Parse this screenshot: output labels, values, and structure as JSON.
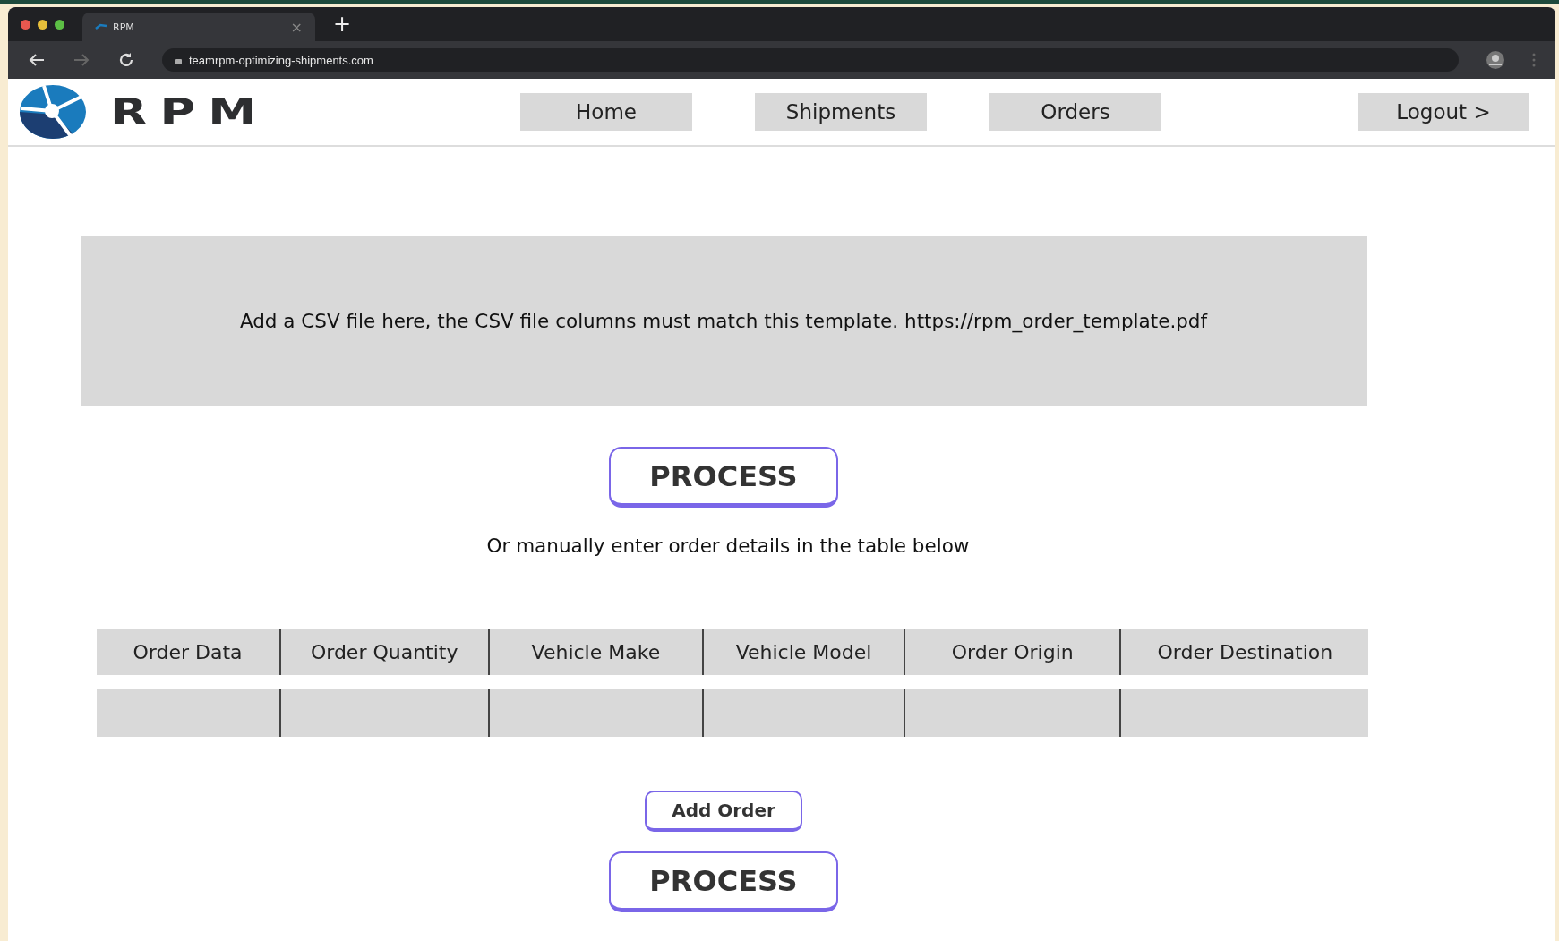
{
  "browser": {
    "tab_title": "RPM",
    "url": "teamrpm-optimizing-shipments.com",
    "new_tab": "+",
    "close_tab": "×"
  },
  "header": {
    "logo_text": "RPM",
    "nav": [
      {
        "label": "Home"
      },
      {
        "label": "Shipments"
      },
      {
        "label": "Orders"
      }
    ],
    "logout": "Logout  >"
  },
  "upload": {
    "text": "Add a CSV file here, the CSV file columns must match this template.",
    "link": "https://rpm_order_template.pdf"
  },
  "process_button": "PROCESS",
  "manual_hint": "Or manually enter order details in the table below",
  "table": {
    "columns": [
      "Order Data",
      "Order Quantity",
      "Vehicle Make",
      "Vehicle Model",
      "Order Origin",
      "Order Destination"
    ]
  },
  "add_button": "Add Order",
  "process_button_2": "PROCESS"
}
